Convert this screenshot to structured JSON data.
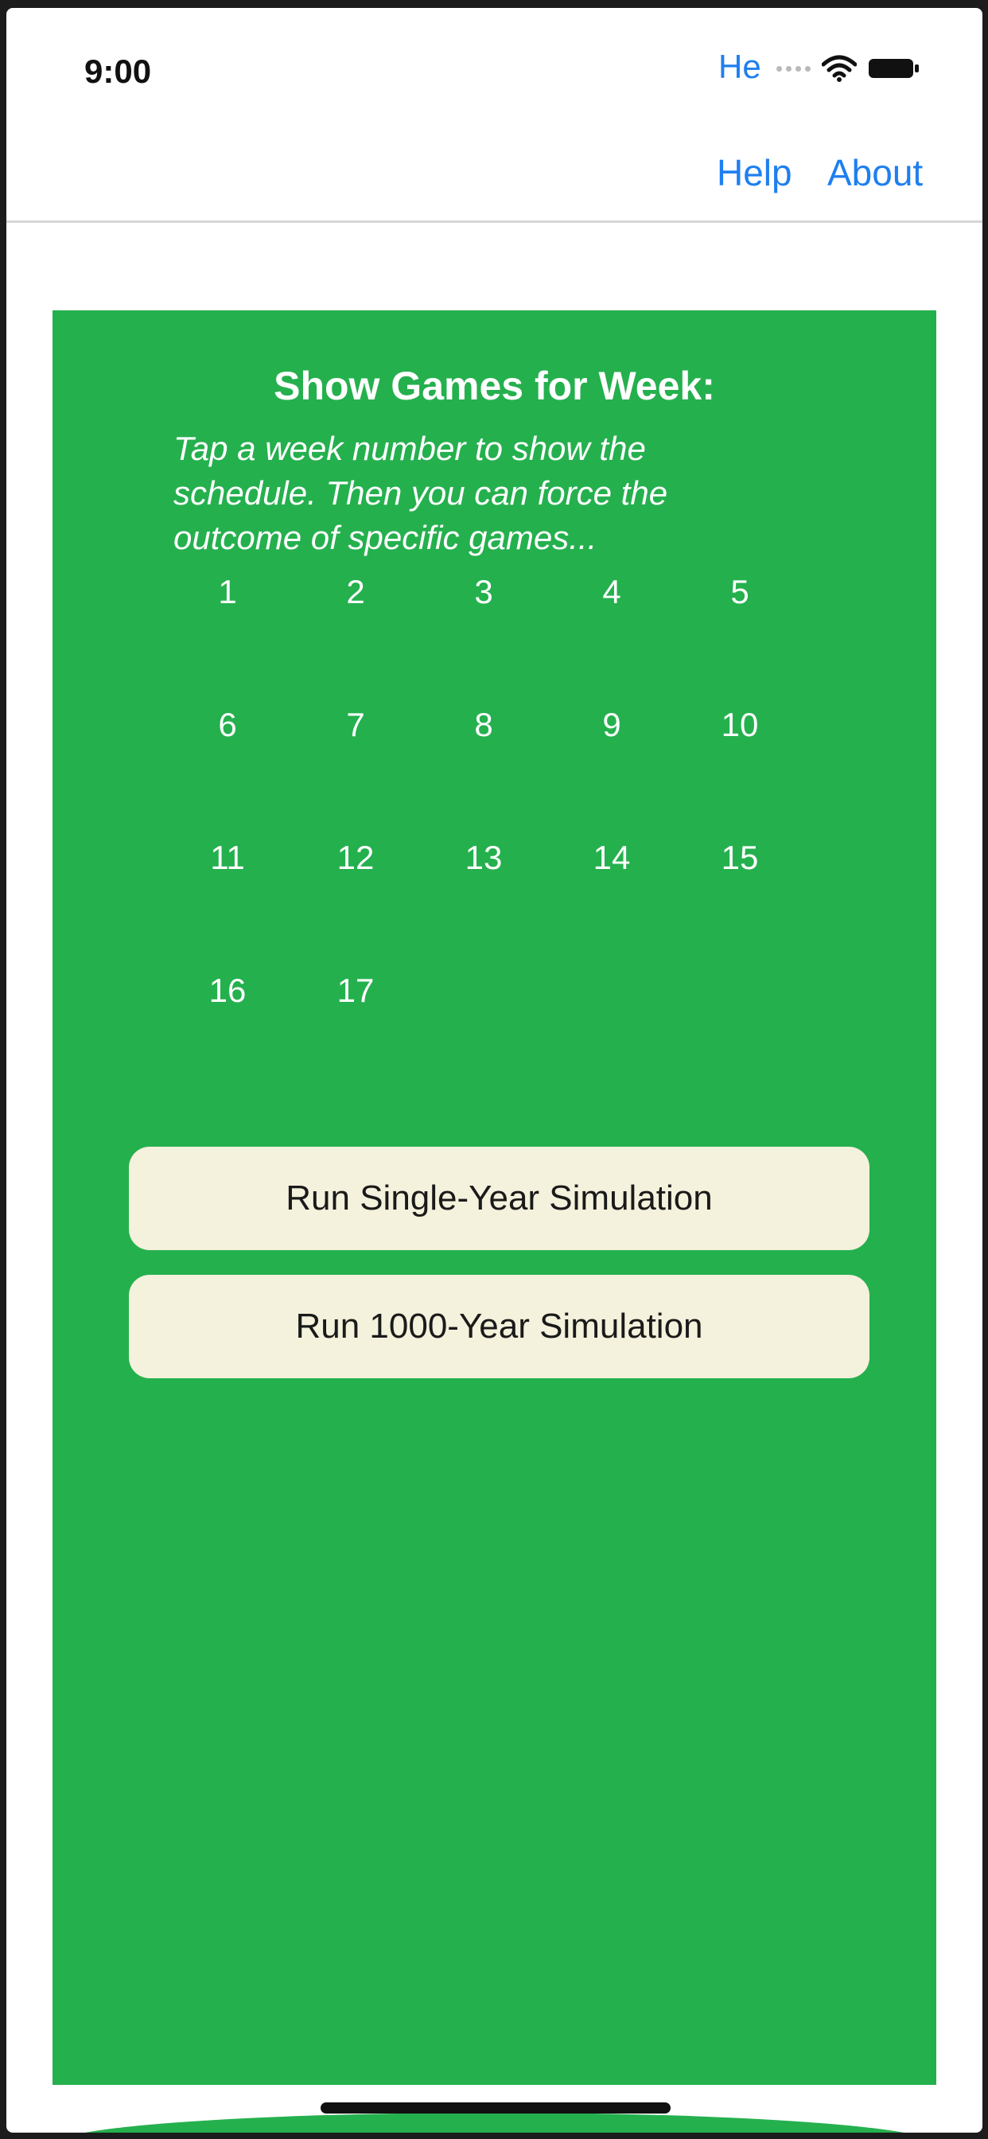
{
  "status_bar": {
    "time": "9:00",
    "partial_title": "He",
    "icons": [
      "signal-icon",
      "wifi-icon",
      "battery-icon"
    ]
  },
  "nav": {
    "help_label": "Help",
    "about_label": "About"
  },
  "panel": {
    "heading": "Show Games for Week:",
    "subtitle": "Tap a week number to show the schedule. Then you can force the outcome of specific games...",
    "weeks": [
      "1",
      "2",
      "3",
      "4",
      "5",
      "6",
      "7",
      "8",
      "9",
      "10",
      "11",
      "12",
      "13",
      "14",
      "15",
      "16",
      "17"
    ],
    "single_sim_label": "Run Single-Year Simulation",
    "thousand_sim_label": "Run 1000-Year Simulation"
  },
  "colors": {
    "accent": "#1e7ff0",
    "panel_green": "#25b04e",
    "button_bg": "#f4f1dc"
  }
}
